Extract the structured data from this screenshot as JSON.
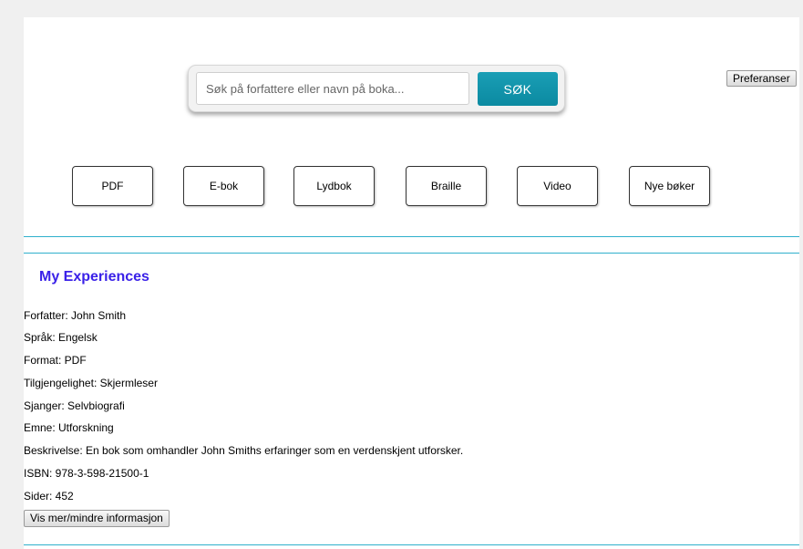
{
  "search": {
    "placeholder": "Søk på forfattere eller navn på boka...",
    "button_label": "SØK"
  },
  "preferences_label": "Preferanser",
  "format_buttons": [
    "PDF",
    "E-bok",
    "Lydbok",
    "Braille",
    "Video",
    "Nye bøker"
  ],
  "section": {
    "title": "My Experiences"
  },
  "details": [
    "Forfatter: John Smith",
    "Språk: Engelsk",
    "Format: PDF",
    "Tilgjengelighet: Skjermleser",
    "Sjanger: Selvbiografi",
    "Emne: Utforskning",
    "Beskrivelse: En bok som omhandler John Smiths erfaringer som en verdenskjent utforsker.",
    "ISBN: 978-3-598-21500-1",
    "Sider: 452"
  ],
  "toggle_label": "Vis mer/mindre informasjon",
  "colors": {
    "accent": "#1a9eb5",
    "divider": "#2fb0cc",
    "title": "#3a21e8"
  }
}
